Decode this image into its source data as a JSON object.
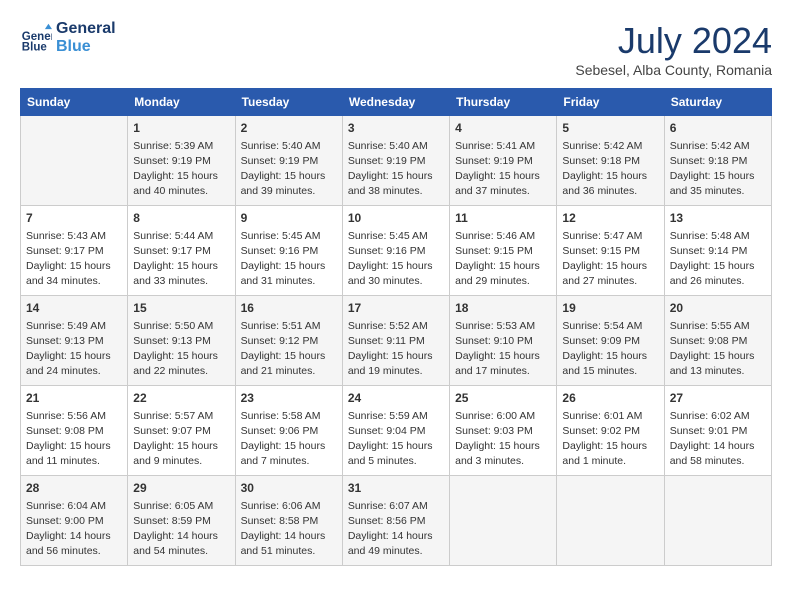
{
  "header": {
    "logo_line1": "General",
    "logo_line2": "Blue",
    "title": "July 2024",
    "location": "Sebesel, Alba County, Romania"
  },
  "days_of_week": [
    "Sunday",
    "Monday",
    "Tuesday",
    "Wednesday",
    "Thursday",
    "Friday",
    "Saturday"
  ],
  "weeks": [
    [
      {
        "day": "",
        "content": ""
      },
      {
        "day": "1",
        "content": "Sunrise: 5:39 AM\nSunset: 9:19 PM\nDaylight: 15 hours\nand 40 minutes."
      },
      {
        "day": "2",
        "content": "Sunrise: 5:40 AM\nSunset: 9:19 PM\nDaylight: 15 hours\nand 39 minutes."
      },
      {
        "day": "3",
        "content": "Sunrise: 5:40 AM\nSunset: 9:19 PM\nDaylight: 15 hours\nand 38 minutes."
      },
      {
        "day": "4",
        "content": "Sunrise: 5:41 AM\nSunset: 9:19 PM\nDaylight: 15 hours\nand 37 minutes."
      },
      {
        "day": "5",
        "content": "Sunrise: 5:42 AM\nSunset: 9:18 PM\nDaylight: 15 hours\nand 36 minutes."
      },
      {
        "day": "6",
        "content": "Sunrise: 5:42 AM\nSunset: 9:18 PM\nDaylight: 15 hours\nand 35 minutes."
      }
    ],
    [
      {
        "day": "7",
        "content": "Sunrise: 5:43 AM\nSunset: 9:17 PM\nDaylight: 15 hours\nand 34 minutes."
      },
      {
        "day": "8",
        "content": "Sunrise: 5:44 AM\nSunset: 9:17 PM\nDaylight: 15 hours\nand 33 minutes."
      },
      {
        "day": "9",
        "content": "Sunrise: 5:45 AM\nSunset: 9:16 PM\nDaylight: 15 hours\nand 31 minutes."
      },
      {
        "day": "10",
        "content": "Sunrise: 5:45 AM\nSunset: 9:16 PM\nDaylight: 15 hours\nand 30 minutes."
      },
      {
        "day": "11",
        "content": "Sunrise: 5:46 AM\nSunset: 9:15 PM\nDaylight: 15 hours\nand 29 minutes."
      },
      {
        "day": "12",
        "content": "Sunrise: 5:47 AM\nSunset: 9:15 PM\nDaylight: 15 hours\nand 27 minutes."
      },
      {
        "day": "13",
        "content": "Sunrise: 5:48 AM\nSunset: 9:14 PM\nDaylight: 15 hours\nand 26 minutes."
      }
    ],
    [
      {
        "day": "14",
        "content": "Sunrise: 5:49 AM\nSunset: 9:13 PM\nDaylight: 15 hours\nand 24 minutes."
      },
      {
        "day": "15",
        "content": "Sunrise: 5:50 AM\nSunset: 9:13 PM\nDaylight: 15 hours\nand 22 minutes."
      },
      {
        "day": "16",
        "content": "Sunrise: 5:51 AM\nSunset: 9:12 PM\nDaylight: 15 hours\nand 21 minutes."
      },
      {
        "day": "17",
        "content": "Sunrise: 5:52 AM\nSunset: 9:11 PM\nDaylight: 15 hours\nand 19 minutes."
      },
      {
        "day": "18",
        "content": "Sunrise: 5:53 AM\nSunset: 9:10 PM\nDaylight: 15 hours\nand 17 minutes."
      },
      {
        "day": "19",
        "content": "Sunrise: 5:54 AM\nSunset: 9:09 PM\nDaylight: 15 hours\nand 15 minutes."
      },
      {
        "day": "20",
        "content": "Sunrise: 5:55 AM\nSunset: 9:08 PM\nDaylight: 15 hours\nand 13 minutes."
      }
    ],
    [
      {
        "day": "21",
        "content": "Sunrise: 5:56 AM\nSunset: 9:08 PM\nDaylight: 15 hours\nand 11 minutes."
      },
      {
        "day": "22",
        "content": "Sunrise: 5:57 AM\nSunset: 9:07 PM\nDaylight: 15 hours\nand 9 minutes."
      },
      {
        "day": "23",
        "content": "Sunrise: 5:58 AM\nSunset: 9:06 PM\nDaylight: 15 hours\nand 7 minutes."
      },
      {
        "day": "24",
        "content": "Sunrise: 5:59 AM\nSunset: 9:04 PM\nDaylight: 15 hours\nand 5 minutes."
      },
      {
        "day": "25",
        "content": "Sunrise: 6:00 AM\nSunset: 9:03 PM\nDaylight: 15 hours\nand 3 minutes."
      },
      {
        "day": "26",
        "content": "Sunrise: 6:01 AM\nSunset: 9:02 PM\nDaylight: 15 hours\nand 1 minute."
      },
      {
        "day": "27",
        "content": "Sunrise: 6:02 AM\nSunset: 9:01 PM\nDaylight: 14 hours\nand 58 minutes."
      }
    ],
    [
      {
        "day": "28",
        "content": "Sunrise: 6:04 AM\nSunset: 9:00 PM\nDaylight: 14 hours\nand 56 minutes."
      },
      {
        "day": "29",
        "content": "Sunrise: 6:05 AM\nSunset: 8:59 PM\nDaylight: 14 hours\nand 54 minutes."
      },
      {
        "day": "30",
        "content": "Sunrise: 6:06 AM\nSunset: 8:58 PM\nDaylight: 14 hours\nand 51 minutes."
      },
      {
        "day": "31",
        "content": "Sunrise: 6:07 AM\nSunset: 8:56 PM\nDaylight: 14 hours\nand 49 minutes."
      },
      {
        "day": "",
        "content": ""
      },
      {
        "day": "",
        "content": ""
      },
      {
        "day": "",
        "content": ""
      }
    ]
  ]
}
